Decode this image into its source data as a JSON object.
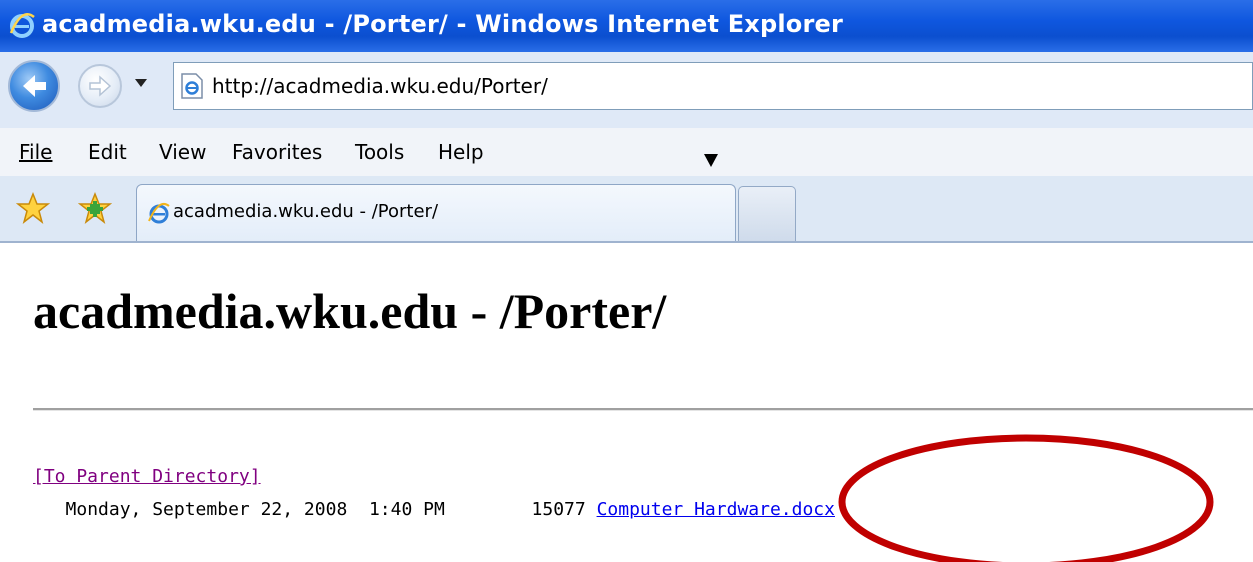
{
  "window": {
    "title": "acadmedia.wku.edu - /Porter/ - Windows Internet Explorer"
  },
  "address_bar": {
    "url": "http://acadmedia.wku.edu/Porter/"
  },
  "menu": {
    "items": [
      "File",
      "Edit",
      "View",
      "Favorites",
      "Tools",
      "Help"
    ]
  },
  "tabs": [
    {
      "label": "acadmedia.wku.edu - /Porter/"
    }
  ],
  "page": {
    "heading": "acadmedia.wku.edu - /Porter/",
    "parent_link": "[To Parent Directory]",
    "entries": [
      {
        "date": "Monday, September 22, 2008",
        "time": "1:40 PM",
        "size": "15077",
        "name": "Computer Hardware.docx"
      }
    ]
  },
  "colors": {
    "titlebar": "#0f57df",
    "visited_link": "#800080",
    "link": "#0000ee",
    "annotation": "#c00000"
  },
  "icons": [
    "ie-logo-icon",
    "back-arrow-icon",
    "forward-arrow-icon",
    "dropdown-arrow-icon",
    "page-icon",
    "favorites-star-icon",
    "add-favorites-icon",
    "mouse-cursor-icon"
  ]
}
